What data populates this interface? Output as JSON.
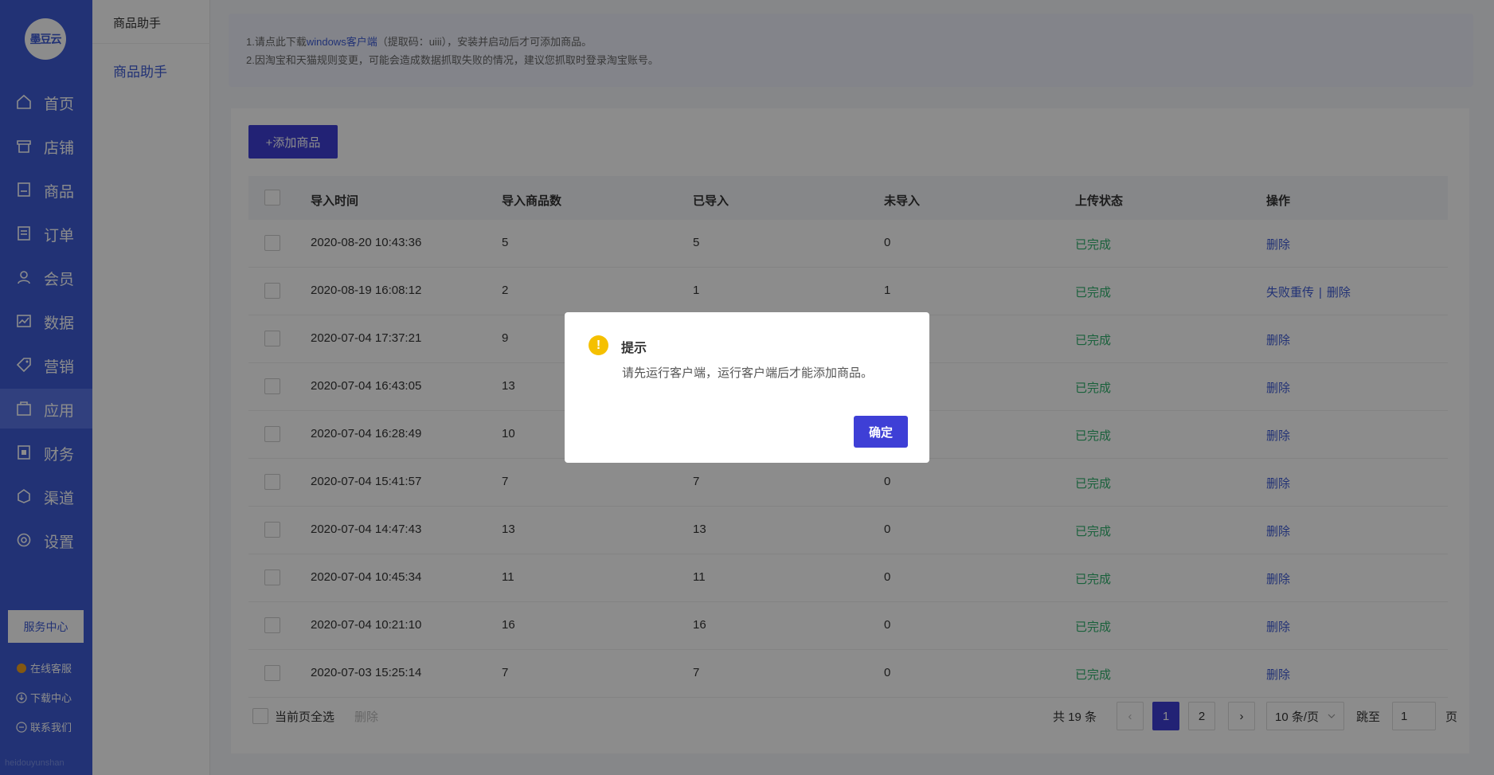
{
  "sidebar": {
    "logo_text": "墨豆云",
    "nav": [
      {
        "label": "首页",
        "icon": "home-icon"
      },
      {
        "label": "店铺",
        "icon": "store-icon"
      },
      {
        "label": "商品",
        "icon": "goods-icon"
      },
      {
        "label": "订单",
        "icon": "order-icon"
      },
      {
        "label": "会员",
        "icon": "user-icon"
      },
      {
        "label": "数据",
        "icon": "chart-icon"
      },
      {
        "label": "营销",
        "icon": "tag-icon"
      },
      {
        "label": "应用",
        "icon": "app-icon",
        "active": true
      },
      {
        "label": "财务",
        "icon": "finance-icon"
      },
      {
        "label": "渠道",
        "icon": "channel-icon"
      },
      {
        "label": "设置",
        "icon": "gear-icon"
      }
    ],
    "service_center": "服务中心",
    "online_service": "在线客服",
    "download_center": "下载中心",
    "contact_us": "联系我们",
    "watermark": "heidouyunshan"
  },
  "submenu": {
    "header": "商品助手",
    "item": "商品助手"
  },
  "notice": {
    "line1_before": "1.请点此下载",
    "line1_link": "windows客户端",
    "line1_after": "（提取码：uiii），安装并启动后才可添加商品。",
    "line2": "2.因淘宝和天猫规则变更，可能会造成数据抓取失败的情况，建议您抓取时登录淘宝账号。"
  },
  "toolbar": {
    "add_label": "+添加商品"
  },
  "table": {
    "columns": [
      "导入时间",
      "导入商品数",
      "已导入",
      "未导入",
      "上传状态",
      "操作"
    ],
    "rows": [
      {
        "time": "2020-08-20 10:43:36",
        "count": "5",
        "done": "5",
        "pending": "0",
        "status": "已完成",
        "actions": [
          "删除"
        ]
      },
      {
        "time": "2020-08-19 16:08:12",
        "count": "2",
        "done": "1",
        "pending": "1",
        "status": "已完成",
        "actions": [
          "失败重传",
          "删除"
        ]
      },
      {
        "time": "2020-07-04 17:37:21",
        "count": "9",
        "done": "",
        "pending": "",
        "status": "已完成",
        "actions": [
          "删除"
        ]
      },
      {
        "time": "2020-07-04 16:43:05",
        "count": "13",
        "done": "",
        "pending": "",
        "status": "已完成",
        "actions": [
          "删除"
        ]
      },
      {
        "time": "2020-07-04 16:28:49",
        "count": "10",
        "done": "",
        "pending": "",
        "status": "已完成",
        "actions": [
          "删除"
        ]
      },
      {
        "time": "2020-07-04 15:41:57",
        "count": "7",
        "done": "7",
        "pending": "0",
        "status": "已完成",
        "actions": [
          "删除"
        ]
      },
      {
        "time": "2020-07-04 14:47:43",
        "count": "13",
        "done": "13",
        "pending": "0",
        "status": "已完成",
        "actions": [
          "删除"
        ]
      },
      {
        "time": "2020-07-04 10:45:34",
        "count": "11",
        "done": "11",
        "pending": "0",
        "status": "已完成",
        "actions": [
          "删除"
        ]
      },
      {
        "time": "2020-07-04 10:21:10",
        "count": "16",
        "done": "16",
        "pending": "0",
        "status": "已完成",
        "actions": [
          "删除"
        ]
      },
      {
        "time": "2020-07-03 15:25:14",
        "count": "7",
        "done": "7",
        "pending": "0",
        "status": "已完成",
        "actions": [
          "删除"
        ]
      }
    ]
  },
  "footer": {
    "select_all": "当前页全选",
    "batch_delete": "删除",
    "total": "共 19 条",
    "prev": "‹",
    "pages": [
      "1",
      "2"
    ],
    "current_page": "1",
    "next": "›",
    "page_size": "10 条/页",
    "jump_label": "跳至",
    "jump_value": "1",
    "page_unit": "页"
  },
  "modal": {
    "icon": "!",
    "title": "提示",
    "message": "请先运行客户端，运行客户端后才能添加商品。",
    "ok_label": "确定"
  },
  "colors": {
    "brand": "#3e5cd6",
    "primary_button": "#3e3fd6",
    "success": "#30b16d",
    "warning": "#f5c000"
  }
}
